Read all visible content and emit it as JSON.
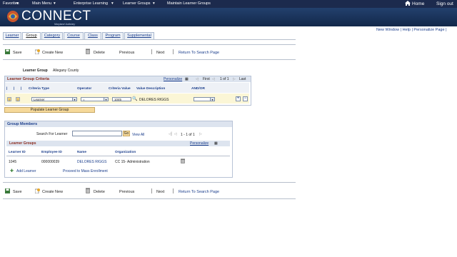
{
  "topnav": {
    "items": [
      "Favorites",
      "Main Menu",
      "Enterprise Learning",
      "Learner Groups",
      "Maintain Learner Groups"
    ],
    "home": "Home",
    "signout": "Sign out"
  },
  "banner": {
    "logo": "CONNECT",
    "subtitle": "Maryland Judiciary"
  },
  "header_links": [
    "New Window",
    "Help",
    "Personalize Page"
  ],
  "tabs": [
    "Learner",
    "Group",
    "Category",
    "Course",
    "Class",
    "Program",
    "Supplemental"
  ],
  "toolbar": {
    "save": "Save",
    "create_new": "Create New",
    "delete": "Delete",
    "previous": "Previous",
    "next": "Next",
    "return": "Return To Search Page"
  },
  "learner_group": {
    "label": "Learner Group",
    "value": "Allegany County"
  },
  "criteria": {
    "title": "Learner Group Criteria",
    "personalize": "Personalize",
    "first": "First",
    "range": "1 of 1",
    "last": "Last",
    "columns": [
      "Criteria Type",
      "Operator",
      "Criteria Value",
      "Value Description",
      "AND/OR"
    ],
    "row": {
      "type": "Learner",
      "operator": "=",
      "value": "1045",
      "description": "DELORES RIGGS",
      "andor": ""
    },
    "populate_button": "Populate Learner Group"
  },
  "members": {
    "title": "Group Members",
    "search_label": "Search For Learner",
    "search_value": "",
    "go": "Go",
    "view_all": "View All",
    "range": "1 - 1 of 1",
    "learner_groups_title": "Learner Groups",
    "personalize": "Personalize",
    "columns": [
      "Learner ID",
      "Employee ID",
      "Name",
      "Organization"
    ],
    "rows": [
      {
        "learner_id": "1045",
        "employee_id": "000000039",
        "name": "DELORES RIGGS",
        "org": "CC 15- Administration"
      }
    ],
    "add_learner": "Add Learner",
    "mass_enroll": "Proceed to Mass Enrollment"
  },
  "colors": {
    "nav": "#1c2a4d",
    "banner": "#23406d",
    "section_title": "#8b2b1e",
    "link": "#1b3e8c"
  }
}
